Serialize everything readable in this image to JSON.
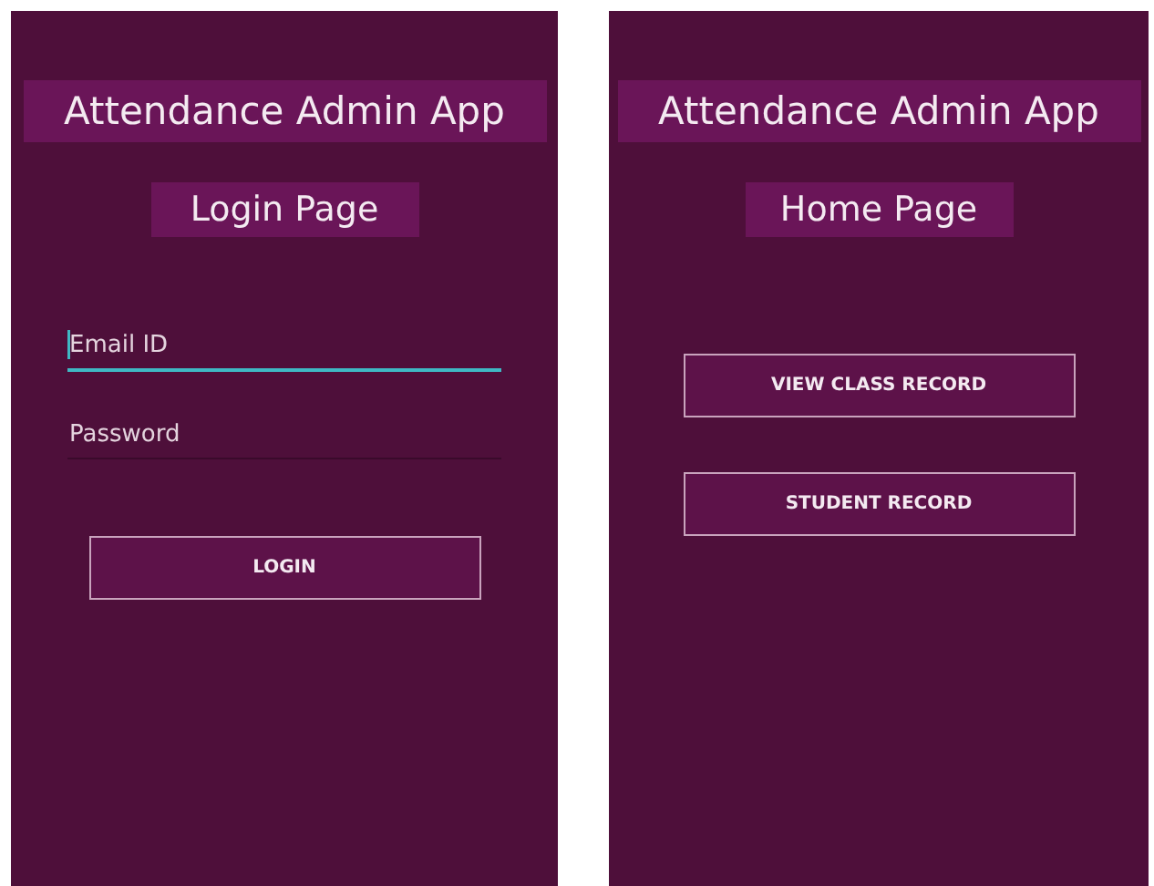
{
  "screens": [
    {
      "title": "Attendance Admin App",
      "subtitle": "Login Page",
      "fields": [
        {
          "placeholder": "Email ID",
          "focused": true
        },
        {
          "placeholder": "Password",
          "focused": false
        }
      ],
      "buttons": [
        "LOGIN"
      ]
    },
    {
      "title": "Attendance Admin App",
      "subtitle": "Home Page",
      "buttons": [
        "VIEW CLASS RECORD",
        "STUDENT RECORD"
      ]
    }
  ]
}
